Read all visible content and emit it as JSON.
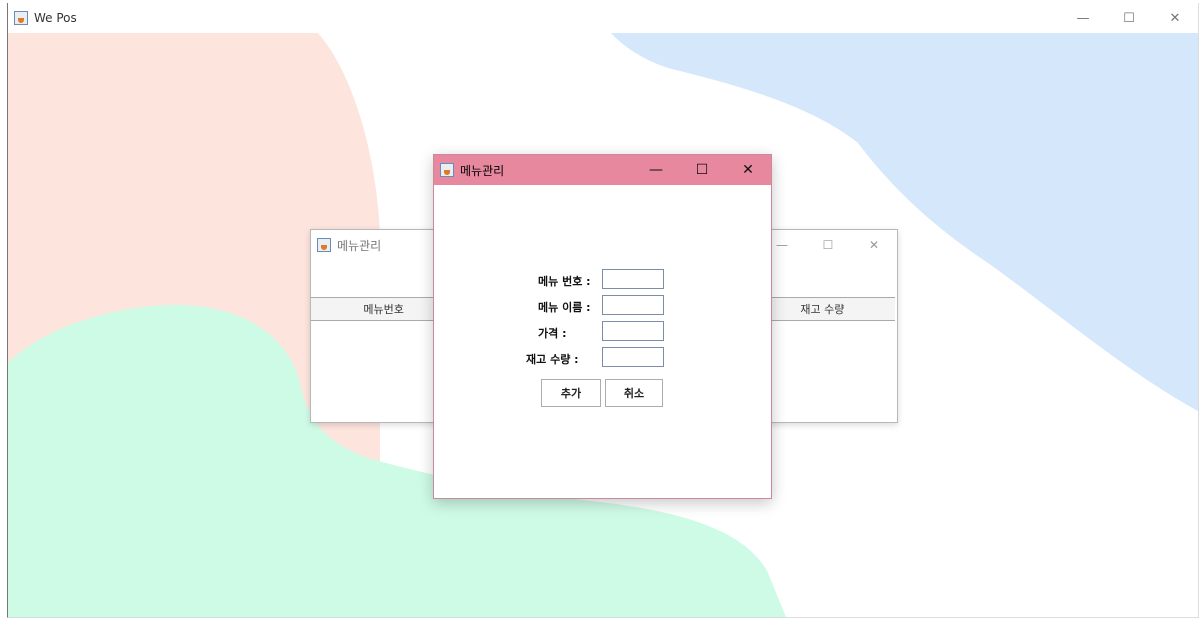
{
  "main_window": {
    "title": "We Pos",
    "controls": {
      "minimize": "—",
      "maximize": "☐",
      "close": "✕"
    }
  },
  "back_dialog": {
    "title": "메뉴관리",
    "columns": [
      "메뉴번호",
      "",
      "",
      "재고 수량"
    ],
    "controls": {
      "minimize": "—",
      "maximize": "☐",
      "close": "✕"
    }
  },
  "front_dialog": {
    "title": "메뉴관리",
    "controls": {
      "minimize": "—",
      "maximize": "☐",
      "close": "✕"
    },
    "fields": [
      {
        "label": "메뉴 번호 :",
        "value": ""
      },
      {
        "label": "메뉴 이름 :",
        "value": ""
      },
      {
        "label": "가격 :",
        "value": ""
      },
      {
        "label": "재고 수량 :",
        "value": ""
      }
    ],
    "buttons": {
      "add": "추가",
      "cancel": "취소"
    }
  },
  "colors": {
    "dialog_titlebar": "#e8889f",
    "blob_pink": "#fde4dd",
    "blob_blue": "#d4e7fb",
    "blob_green": "#cefbe6"
  }
}
